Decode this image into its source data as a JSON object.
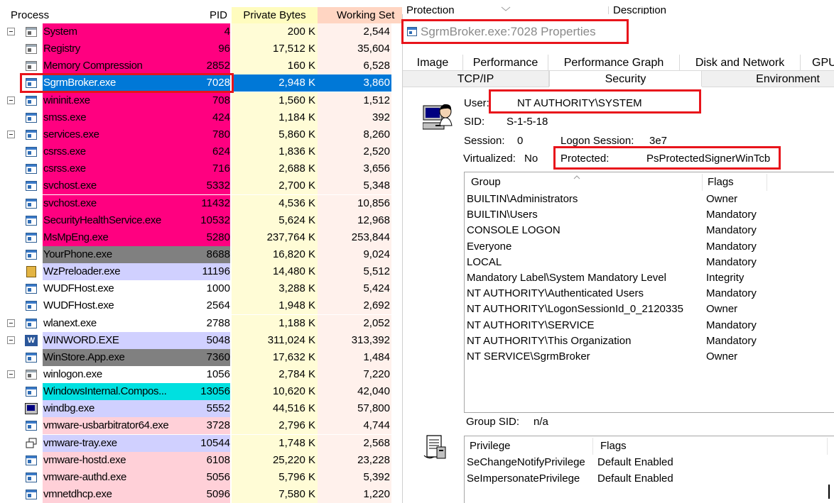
{
  "columns": {
    "process": "Process",
    "pid": "PID",
    "private_bytes": "Private Bytes",
    "working_set": "Working Set",
    "protection": "Protection",
    "description": "Description"
  },
  "processes": [
    {
      "name": "System",
      "pid": "4",
      "private": "200 K",
      "ws": "2,544",
      "color": "#ff0080",
      "tree": "minus",
      "icon": "gray"
    },
    {
      "name": "Registry",
      "pid": "96",
      "private": "17,512 K",
      "ws": "35,604",
      "color": "#ff0080",
      "tree": "",
      "icon": "gray"
    },
    {
      "name": "Memory Compression",
      "pid": "2852",
      "private": "160 K",
      "ws": "6,528",
      "color": "#ff0080",
      "tree": "",
      "icon": "gray"
    },
    {
      "name": "SgrmBroker.exe",
      "pid": "7028",
      "private": "2,948 K",
      "ws": "3,860",
      "color": "#0078d7",
      "tree": "",
      "icon": "app",
      "selected": true
    },
    {
      "name": "wininit.exe",
      "pid": "708",
      "private": "1,560 K",
      "ws": "1,512",
      "color": "#ff0080",
      "tree": "minus",
      "icon": "app"
    },
    {
      "name": "smss.exe",
      "pid": "424",
      "private": "1,184 K",
      "ws": "392",
      "color": "#ff0080",
      "tree": "",
      "icon": "app"
    },
    {
      "name": "services.exe",
      "pid": "780",
      "private": "5,860 K",
      "ws": "8,260",
      "color": "#ff0080",
      "tree": "minus",
      "icon": "app"
    },
    {
      "name": "csrss.exe",
      "pid": "624",
      "private": "1,836 K",
      "ws": "2,520",
      "color": "#ff0080",
      "tree": "",
      "icon": "app"
    },
    {
      "name": "csrss.exe",
      "pid": "716",
      "private": "2,688 K",
      "ws": "3,656",
      "color": "#ff0080",
      "tree": "",
      "icon": "app"
    },
    {
      "name": "svchost.exe",
      "pid": "5332",
      "private": "2,700 K",
      "ws": "5,348",
      "color": "#ff0080",
      "tree": "",
      "icon": "app"
    },
    {
      "name": "svchost.exe",
      "pid": "11432",
      "private": "4,536 K",
      "ws": "10,856",
      "color": "#ff0080",
      "tree": "",
      "icon": "app"
    },
    {
      "name": "SecurityHealthService.exe",
      "pid": "10532",
      "private": "5,624 K",
      "ws": "12,968",
      "color": "#ff0080",
      "tree": "",
      "icon": "app"
    },
    {
      "name": "MsMpEng.exe",
      "pid": "5280",
      "private": "237,764 K",
      "ws": "253,844",
      "color": "#ff0080",
      "tree": "",
      "icon": "app"
    },
    {
      "name": "YourPhone.exe",
      "pid": "8688",
      "private": "16,820 K",
      "ws": "9,024",
      "color": "#808080",
      "tree": "",
      "icon": "app"
    },
    {
      "name": "WzPreloader.exe",
      "pid": "11196",
      "private": "14,480 K",
      "ws": "5,512",
      "color": "#d0d0ff",
      "tree": "",
      "icon": "zip"
    },
    {
      "name": "WUDFHost.exe",
      "pid": "1000",
      "private": "3,288 K",
      "ws": "5,424",
      "color": "#ffffff",
      "tree": "",
      "icon": "app"
    },
    {
      "name": "WUDFHost.exe",
      "pid": "2564",
      "private": "1,948 K",
      "ws": "2,692",
      "color": "#ffffff",
      "tree": "",
      "icon": "app"
    },
    {
      "name": "wlanext.exe",
      "pid": "2788",
      "private": "1,188 K",
      "ws": "2,052",
      "color": "#ffffff",
      "tree": "minus",
      "icon": "app"
    },
    {
      "name": "WINWORD.EXE",
      "pid": "5048",
      "private": "311,024 K",
      "ws": "313,392",
      "color": "#d0d0ff",
      "tree": "minus",
      "icon": "word"
    },
    {
      "name": "WinStore.App.exe",
      "pid": "7360",
      "private": "17,632 K",
      "ws": "1,484",
      "color": "#808080",
      "tree": "",
      "icon": "app"
    },
    {
      "name": "winlogon.exe",
      "pid": "1056",
      "private": "2,784 K",
      "ws": "7,220",
      "color": "#ffffff",
      "tree": "minus",
      "icon": "gray"
    },
    {
      "name": "WindowsInternal.Compos...",
      "pid": "13056",
      "private": "10,620 K",
      "ws": "42,040",
      "color": "#00e0e0",
      "tree": "",
      "icon": "app"
    },
    {
      "name": "windbg.exe",
      "pid": "5552",
      "private": "44,516 K",
      "ws": "57,800",
      "color": "#d0d0ff",
      "tree": "",
      "icon": "dbg"
    },
    {
      "name": "vmware-usbarbitrator64.exe",
      "pid": "3728",
      "private": "2,796 K",
      "ws": "4,744",
      "color": "#ffd0d8",
      "tree": "",
      "icon": "app"
    },
    {
      "name": "vmware-tray.exe",
      "pid": "10544",
      "private": "1,748 K",
      "ws": "2,568",
      "color": "#d0d0ff",
      "tree": "",
      "icon": "tray"
    },
    {
      "name": "vmware-hostd.exe",
      "pid": "6108",
      "private": "25,220 K",
      "ws": "23,228",
      "color": "#ffd0d8",
      "tree": "",
      "icon": "app"
    },
    {
      "name": "vmware-authd.exe",
      "pid": "5056",
      "private": "5,796 K",
      "ws": "5,392",
      "color": "#ffd0d8",
      "tree": "",
      "icon": "app"
    },
    {
      "name": "vmnetdhcp.exe",
      "pid": "5096",
      "private": "7,580 K",
      "ws": "1,220",
      "color": "#ffd0d8",
      "tree": "",
      "icon": "app"
    }
  ],
  "dialog": {
    "title": "SgrmBroker.exe:7028 Properties",
    "tabs_row1": [
      "Image",
      "Performance",
      "Performance Graph",
      "Disk and Network",
      "GPU"
    ],
    "tabs_row2": [
      "TCP/IP",
      "Security",
      "Environment"
    ],
    "active_tab": "Security",
    "user_label": "User:",
    "user_value": "NT AUTHORITY\\SYSTEM",
    "sid_label": "SID:",
    "sid_value": "S-1-5-18",
    "session_label": "Session:",
    "session_value": "0",
    "logon_label": "Logon Session:",
    "logon_value": "3e7",
    "virtualized_label": "Virtualized:",
    "virtualized_value": "No",
    "protected_label": "Protected:",
    "protected_value": "PsProtectedSignerWinTcb",
    "groups_header": {
      "group": "Group",
      "flags": "Flags"
    },
    "groups": [
      {
        "group": "BUILTIN\\Administrators",
        "flags": "Owner"
      },
      {
        "group": "BUILTIN\\Users",
        "flags": "Mandatory"
      },
      {
        "group": "CONSOLE LOGON",
        "flags": "Mandatory"
      },
      {
        "group": "Everyone",
        "flags": "Mandatory"
      },
      {
        "group": "LOCAL",
        "flags": "Mandatory"
      },
      {
        "group": "Mandatory Label\\System Mandatory Level",
        "flags": "Integrity"
      },
      {
        "group": "NT AUTHORITY\\Authenticated Users",
        "flags": "Mandatory"
      },
      {
        "group": "NT AUTHORITY\\LogonSessionId_0_2120335",
        "flags": "Owner"
      },
      {
        "group": "NT AUTHORITY\\SERVICE",
        "flags": "Mandatory"
      },
      {
        "group": "NT AUTHORITY\\This Organization",
        "flags": "Mandatory"
      },
      {
        "group": "NT SERVICE\\SgrmBroker",
        "flags": "Owner"
      }
    ],
    "group_sid_label": "Group SID:",
    "group_sid_value": "n/a",
    "privileges_header": {
      "privilege": "Privilege",
      "flags": "Flags"
    },
    "privileges": [
      {
        "privilege": "SeChangeNotifyPrivilege",
        "flags": "Default Enabled"
      },
      {
        "privilege": "SeImpersonatePrivilege",
        "flags": "Default Enabled"
      }
    ]
  },
  "colors": {
    "highlight_box": "#e8141b",
    "selection": "#0078d7",
    "private_bytes_header": "#fffcbe",
    "working_set_header": "#ffd5c2"
  }
}
